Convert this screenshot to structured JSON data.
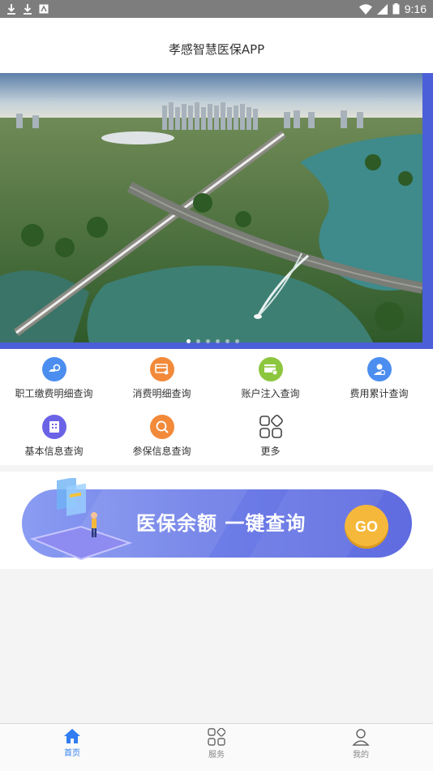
{
  "status_bar": {
    "time": "9:16"
  },
  "header": {
    "title": "孝感智慧医保APP"
  },
  "banner": {
    "slide_count": 6,
    "active_index": 0
  },
  "menu": {
    "items": [
      {
        "label": "职工缴费明细查询",
        "icon": "payment-detail-icon",
        "color": "#4b8ef0"
      },
      {
        "label": "消费明细查询",
        "icon": "consumption-detail-icon",
        "color": "#f28a3a"
      },
      {
        "label": "账户注入查询",
        "icon": "account-injection-icon",
        "color": "#8cc63f"
      },
      {
        "label": "费用累计查询",
        "icon": "cost-accumulation-icon",
        "color": "#4b8ef0"
      },
      {
        "label": "基本信息查询",
        "icon": "basic-info-icon",
        "color": "#6b63e6"
      },
      {
        "label": "参保信息查询",
        "icon": "insurance-info-icon",
        "color": "#f28a3a"
      },
      {
        "label": "更多",
        "icon": "more-grid-icon",
        "color": "#444444"
      }
    ]
  },
  "promo": {
    "text": "医保余额 一键查询",
    "button": "GO"
  },
  "tabbar": {
    "tabs": [
      {
        "label": "首页",
        "icon": "home-icon",
        "active": true
      },
      {
        "label": "服务",
        "icon": "service-grid-icon",
        "active": false
      },
      {
        "label": "我的",
        "icon": "user-icon",
        "active": false
      }
    ]
  }
}
